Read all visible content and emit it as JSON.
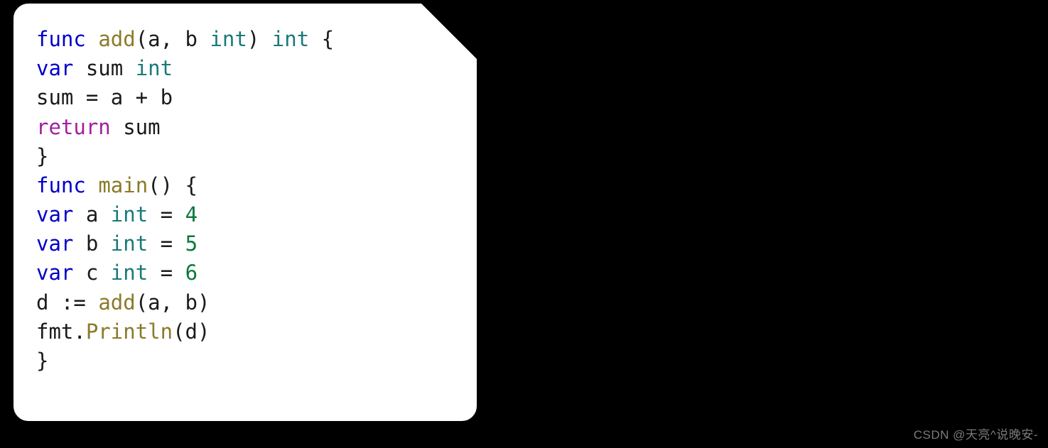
{
  "code": {
    "line1": {
      "t1": "func",
      "t2": " ",
      "t3": "add",
      "t4": "(a, b ",
      "t5": "int",
      "t6": ") ",
      "t7": "int",
      "t8": " {"
    },
    "line2": {
      "t1": "var",
      "t2": " sum ",
      "t3": "int"
    },
    "line3": {
      "t1": "sum = a + b"
    },
    "line4": {
      "t1": "return",
      "t2": " sum"
    },
    "line5": {
      "t1": "}"
    },
    "line6": {
      "t1": "func",
      "t2": " ",
      "t3": "main",
      "t4": "() {"
    },
    "line7": {
      "t1": "var",
      "t2": " a ",
      "t3": "int",
      "t4": " = ",
      "t5": "4"
    },
    "line8": {
      "t1": "var",
      "t2": " b ",
      "t3": "int",
      "t4": " = ",
      "t5": "5"
    },
    "line9": {
      "t1": "var",
      "t2": " c ",
      "t3": "int",
      "t4": " = ",
      "t5": "6"
    },
    "line10": {
      "t1": "d := ",
      "t2": "add",
      "t3": "(a, b)"
    },
    "line11": {
      "t1": "fmt.",
      "t2": "Println",
      "t3": "(d)"
    },
    "line12": {
      "t1": "}"
    }
  },
  "watermark": "CSDN @天亮^说晚安-"
}
